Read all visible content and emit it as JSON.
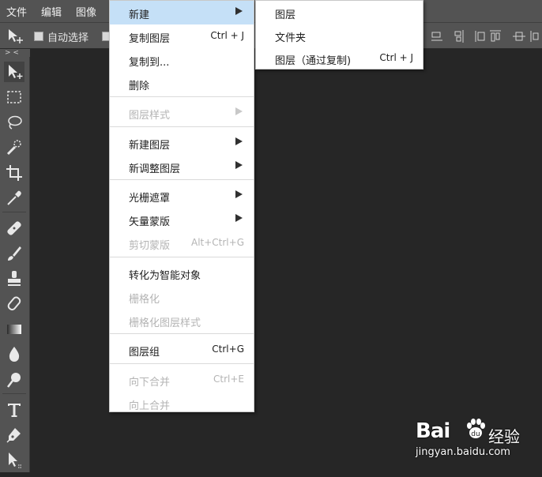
{
  "menubar": {
    "items": [
      "文件",
      "编辑",
      "图像"
    ]
  },
  "options": {
    "auto_select_label": "自动选择"
  },
  "panel_toggle": "> <",
  "layer_menu": {
    "new": "新建",
    "duplicate_layer": {
      "label": "复制图层",
      "shortcut": "Ctrl + J"
    },
    "duplicate_to": "复制到...",
    "delete": "删除",
    "layer_style": "图层样式",
    "new_fill_layer": "新建图层",
    "new_adjustment_layer": "新调整图层",
    "raster_mask": "光栅遮罩",
    "vector_mask": "矢量蒙版",
    "clipping_mask": {
      "label": "剪切蒙版",
      "shortcut": "Alt+Ctrl+G"
    },
    "convert_smart": "转化为智能对象",
    "rasterize": "栅格化",
    "rasterize_style": "栅格化图层样式",
    "group": {
      "label": "图层组",
      "shortcut": "Ctrl+G"
    },
    "merge_down": {
      "label": "向下合并",
      "shortcut": "Ctrl+E"
    },
    "merge_up": "向上合并"
  },
  "new_submenu": {
    "layer": "图层",
    "folder": "文件夹",
    "layer_via_copy": {
      "label": "图层（通过复制)",
      "shortcut": "Ctrl + J"
    }
  },
  "watermark": {
    "brand": "Bai",
    "brand2": "经验",
    "url": "jingyan.baidu.com"
  },
  "colors": {
    "highlight": "#c5e0f7",
    "ui_gray": "#535353",
    "canvas": "#262626"
  }
}
